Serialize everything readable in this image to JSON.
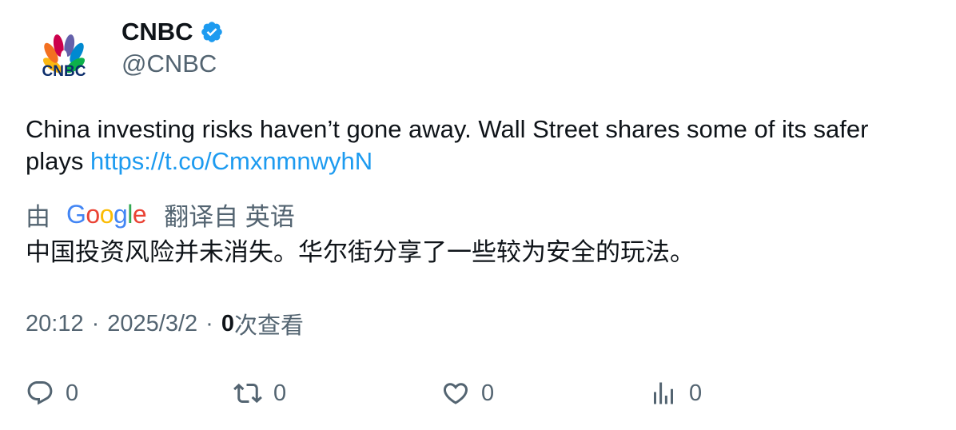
{
  "account": {
    "logo_text": "CNBC",
    "name": "CNBC",
    "handle": "@CNBC",
    "verified": true
  },
  "tweet": {
    "text": "China investing risks haven’t gone away. Wall Street shares some of its safer plays ",
    "link": "https://t.co/CmxnmnwyhN"
  },
  "translation": {
    "prefix": "由",
    "brand": "Google",
    "suffix": "翻译自 英语",
    "text": "中国投资风险并未消失。华尔街分享了一些较为安全的玩法。"
  },
  "meta": {
    "time": "20:12",
    "separator": "·",
    "date": "2025/3/2",
    "views_count": "0",
    "views_label": "次查看"
  },
  "actions": {
    "reply_count": "0",
    "retweet_count": "0",
    "like_count": "0",
    "views_count": "0"
  },
  "colors": {
    "link": "#1d9bf0",
    "muted": "#536471",
    "text": "#0f1419",
    "verified": "#1d9bf0"
  },
  "icons": [
    "cnbc-peacock-logo",
    "verified-badge-icon",
    "google-logo",
    "reply-icon",
    "retweet-icon",
    "like-icon",
    "views-icon"
  ]
}
